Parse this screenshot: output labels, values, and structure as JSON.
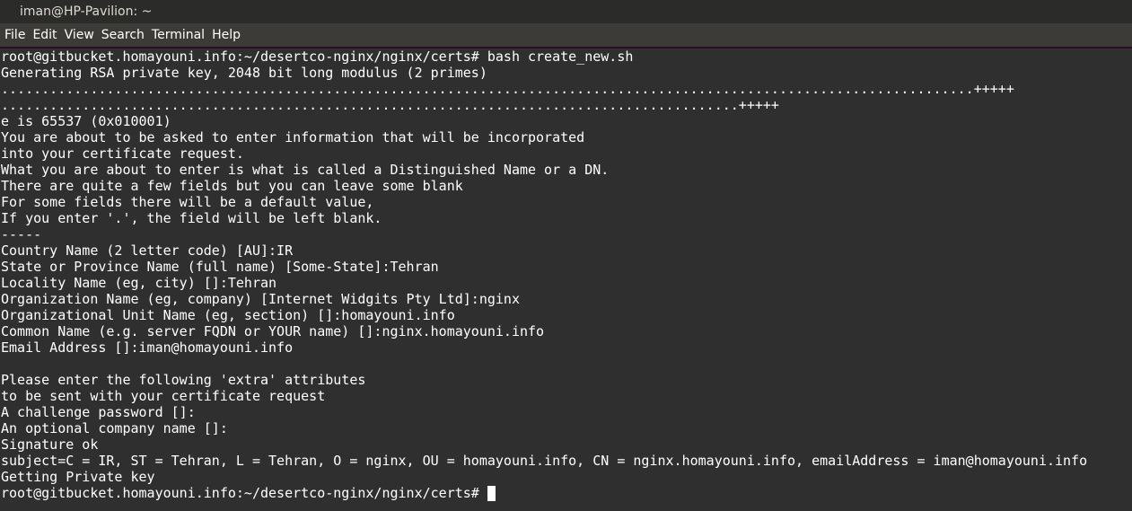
{
  "window": {
    "title": "iman@HP-Pavilion: ~"
  },
  "menu": {
    "items": [
      "File",
      "Edit",
      "View",
      "Search",
      "Terminal",
      "Help"
    ]
  },
  "terminal": {
    "lines": [
      "root@gitbucket.homayouni.info:~/desertco-nginx/nginx/certs# bash create_new.sh",
      "Generating RSA private key, 2048 bit long modulus (2 primes)",
      "........................................................................................................................+++++",
      "...........................................................................................+++++",
      "e is 65537 (0x010001)",
      "You are about to be asked to enter information that will be incorporated",
      "into your certificate request.",
      "What you are about to enter is what is called a Distinguished Name or a DN.",
      "There are quite a few fields but you can leave some blank",
      "For some fields there will be a default value,",
      "If you enter '.', the field will be left blank.",
      "-----",
      "Country Name (2 letter code) [AU]:IR",
      "State or Province Name (full name) [Some-State]:Tehran",
      "Locality Name (eg, city) []:Tehran",
      "Organization Name (eg, company) [Internet Widgits Pty Ltd]:nginx",
      "Organizational Unit Name (eg, section) []:homayouni.info",
      "Common Name (e.g. server FQDN or YOUR name) []:nginx.homayouni.info",
      "Email Address []:iman@homayouni.info",
      "",
      "Please enter the following 'extra' attributes",
      "to be sent with your certificate request",
      "A challenge password []:",
      "An optional company name []:",
      "Signature ok",
      "subject=C = IR, ST = Tehran, L = Tehran, O = nginx, OU = homayouni.info, CN = nginx.homayouni.info, emailAddress = iman@homayouni.info",
      "Getting Private key"
    ],
    "prompt": "root@gitbucket.homayouni.info:~/desertco-nginx/nginx/certs# "
  }
}
